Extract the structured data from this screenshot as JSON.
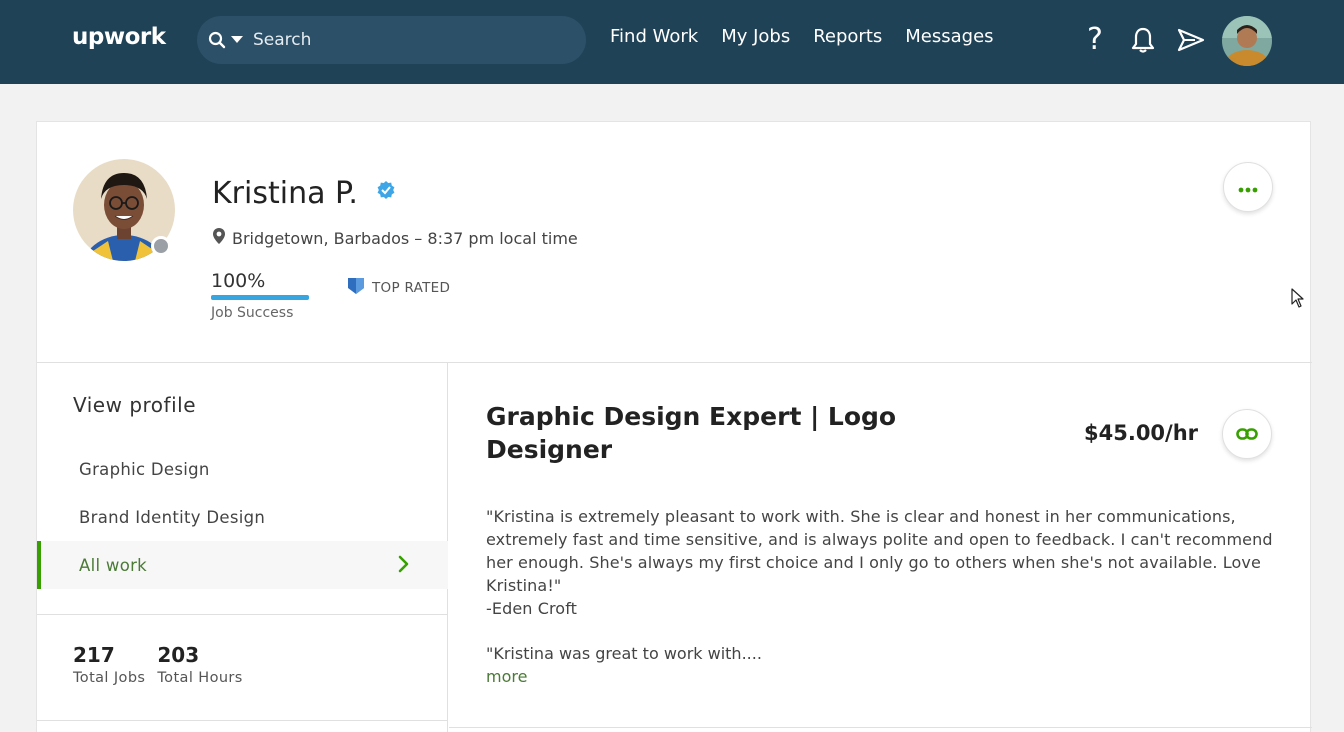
{
  "nav": {
    "logo": "upwork",
    "search_placeholder": "Search",
    "links": [
      "Find Work",
      "My Jobs",
      "Reports",
      "Messages"
    ],
    "help_label": "?",
    "icons": [
      "search-icon",
      "caret-down-icon",
      "bell-icon",
      "send-icon",
      "avatar"
    ]
  },
  "profile": {
    "name": "Kristina P.",
    "location": "Bridgetown, Barbados – 8:37 pm local time",
    "job_success_value": "100%",
    "job_success_fraction": 1.0,
    "job_success_label": "Job Success",
    "badge": "TOP RATED"
  },
  "sidebar": {
    "heading": "View profile",
    "items": [
      {
        "label": "Graphic Design",
        "active": false
      },
      {
        "label": "Brand Identity Design",
        "active": false
      },
      {
        "label": "All work",
        "active": true
      }
    ],
    "stats": [
      {
        "value": "217",
        "label": "Total Jobs"
      },
      {
        "value": "203",
        "label": "Total Hours"
      }
    ]
  },
  "main": {
    "title": "Graphic Design Expert | Logo Designer",
    "rate": "$45.00/hr",
    "review_text": "\"Kristina is extremely pleasant to work with. She is clear and honest in her communications, extremely fast and time sensitive, and is always polite and open to feedback. I can't recommend her enough. She's always my first choice and I only go to others when she's not available. Love Kristina!\"",
    "review_author": "-Eden Croft",
    "review2_text": "\"Kristina was great to work with....",
    "more_label": "more"
  },
  "colors": {
    "nav_bg": "#1f4257",
    "accent_green": "#37a000",
    "progress_blue": "#37a5e0",
    "verified_blue": "#3ea6e6"
  }
}
